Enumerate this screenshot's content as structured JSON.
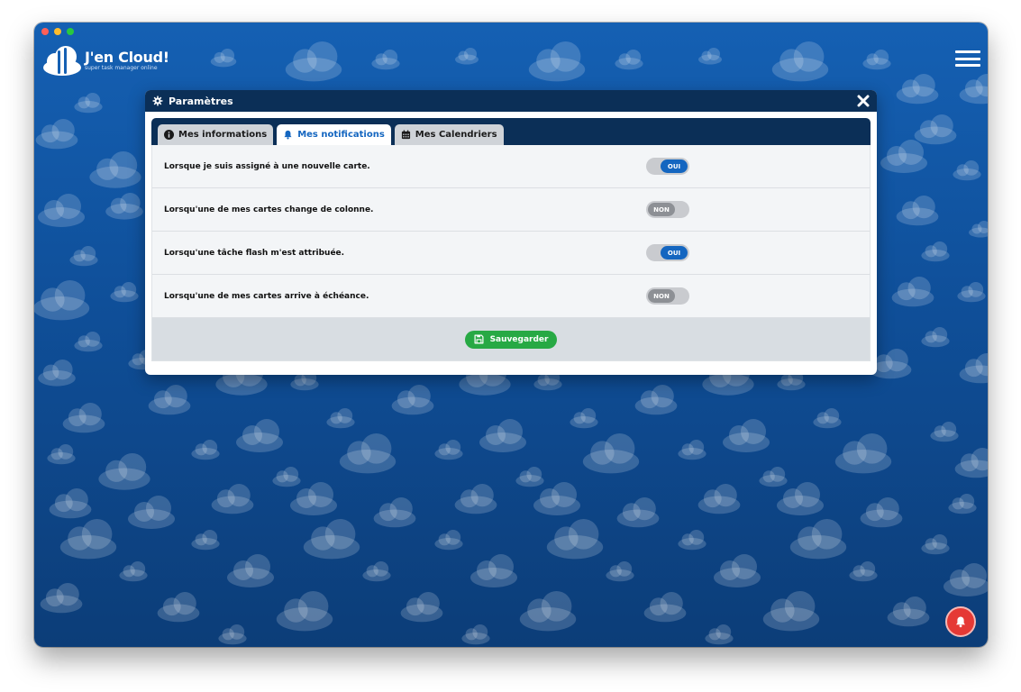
{
  "app": {
    "logo_title": "J'en Cloud!",
    "logo_subtitle": "super task manager online"
  },
  "modal": {
    "title": "Paramètres",
    "tabs": [
      {
        "label": "Mes informations",
        "icon": "info-circle-icon",
        "active": false
      },
      {
        "label": "Mes notifications",
        "icon": "bell-icon",
        "active": true
      },
      {
        "label": "Mes Calendriers",
        "icon": "calendar-icon",
        "active": false
      }
    ],
    "rows": [
      {
        "label": "Lorsque je suis assigné à une nouvelle carte.",
        "state": "OUI",
        "on": true
      },
      {
        "label": "Lorsqu'une de mes cartes change de colonne.",
        "state": "NON",
        "on": false
      },
      {
        "label": "Lorsqu'une tâche flash m'est attribuée.",
        "state": "OUI",
        "on": true
      },
      {
        "label": "Lorsqu'une de mes cartes arrive à échéance.",
        "state": "NON",
        "on": false
      }
    ],
    "save_label": "Sauvegarder"
  },
  "colors": {
    "background": "#1560b3",
    "header": "#0b2f57",
    "accent": "#1466c0",
    "save": "#27a944",
    "alert": "#e53935"
  }
}
